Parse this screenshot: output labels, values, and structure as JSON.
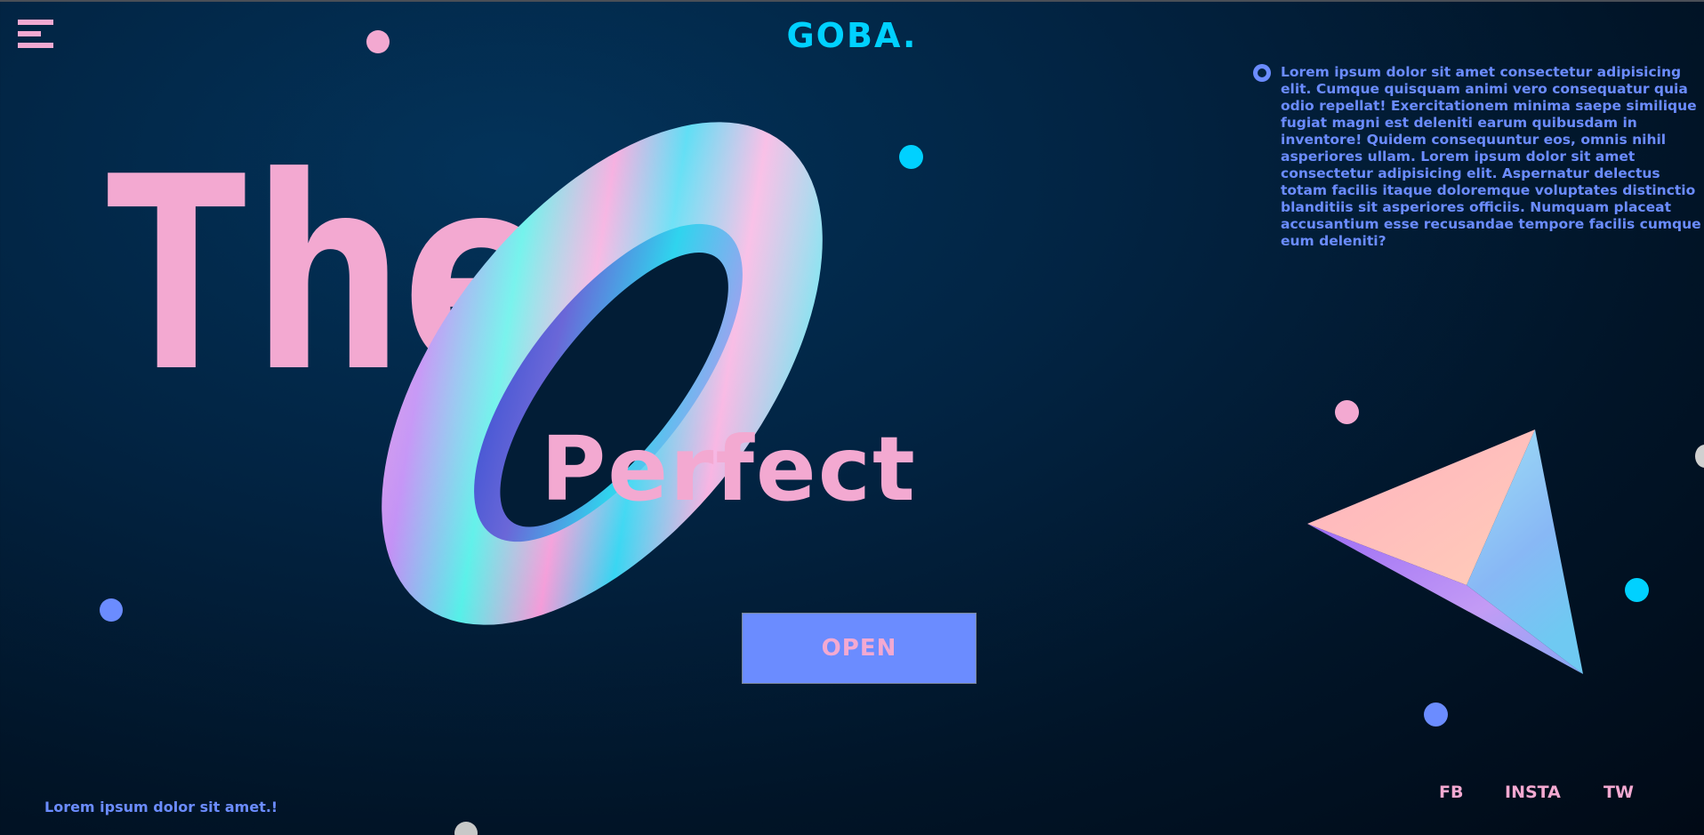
{
  "brand": {
    "logo": "GOBA."
  },
  "hero": {
    "title_the": "The",
    "title_perfect": "Perfect"
  },
  "cta": {
    "open_label": "OPEN"
  },
  "info": {
    "paragraph": "Lorem ipsum dolor sit amet consectetur adipisicing elit. Cumque quisquam animi vero consequatur quia odio repellat! Exercitationem minima saepe similique fugiat magni est deleniti earum quibusdam in inventore! Quidem consequuntur eos, omnis nihil asperiores ullam. Lorem ipsum dolor sit amet consectetur adipisicing elit. Aspernatur delectus totam facilis itaque doloremque voluptates distinctio blanditiis sit asperiores officiis. Numquam placeat accusantium esse recusandae tempore facilis cumque eum deleniti?"
  },
  "footer": {
    "tagline": "Lorem ipsum dolor sit amet.!",
    "social": [
      "FB",
      "INSTA",
      "TW"
    ]
  },
  "icons": {
    "menu": "hamburger-menu-icon",
    "bullet": "radio-bullet-icon",
    "torus": "holographic-torus-graphic",
    "pyramid": "holographic-pyramid-graphic"
  },
  "colors": {
    "background": "#011c36",
    "accent_pink": "#f3a9d1",
    "accent_blue": "#6b8cff",
    "accent_cyan": "#00d1ff",
    "dot_gray": "#c8c8c8"
  }
}
